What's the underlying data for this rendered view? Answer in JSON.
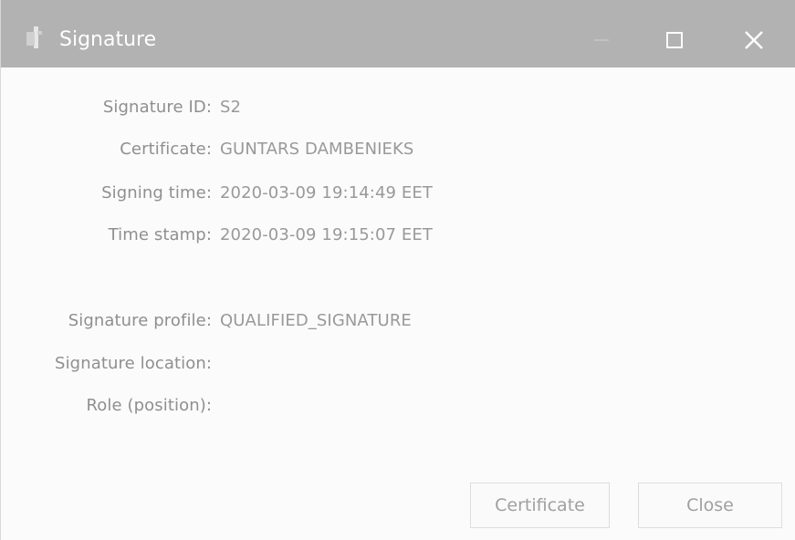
{
  "window": {
    "title": "Signature",
    "icon": "signature-app-icon",
    "controls": {
      "minimize_icon": "minimize-icon",
      "maximize_icon": "maximize-icon",
      "close_icon": "close-icon"
    }
  },
  "details": {
    "signature_id": {
      "label": "Signature ID:",
      "value": "S2"
    },
    "certificate": {
      "label": "Certificate:",
      "value": "GUNTARS DAMBENIEKS"
    },
    "signing_time": {
      "label": "Signing time:",
      "value": "2020-03-09 19:14:49 EET"
    },
    "time_stamp": {
      "label": "Time stamp:",
      "value": "2020-03-09 19:15:07 EET"
    },
    "signature_profile": {
      "label": "Signature profile:",
      "value": "QUALIFIED_SIGNATURE"
    },
    "signature_location": {
      "label": "Signature location:",
      "value": ""
    },
    "role": {
      "label": "Role (position):",
      "value": ""
    }
  },
  "buttons": {
    "certificate_label": "Certificate",
    "close_label": "Close"
  },
  "colors": {
    "titlebar": "#b2b2b2",
    "title_text": "#ffffff",
    "label_text": "#8f8f8f",
    "value_text": "#999999",
    "button_border": "#dedede"
  }
}
